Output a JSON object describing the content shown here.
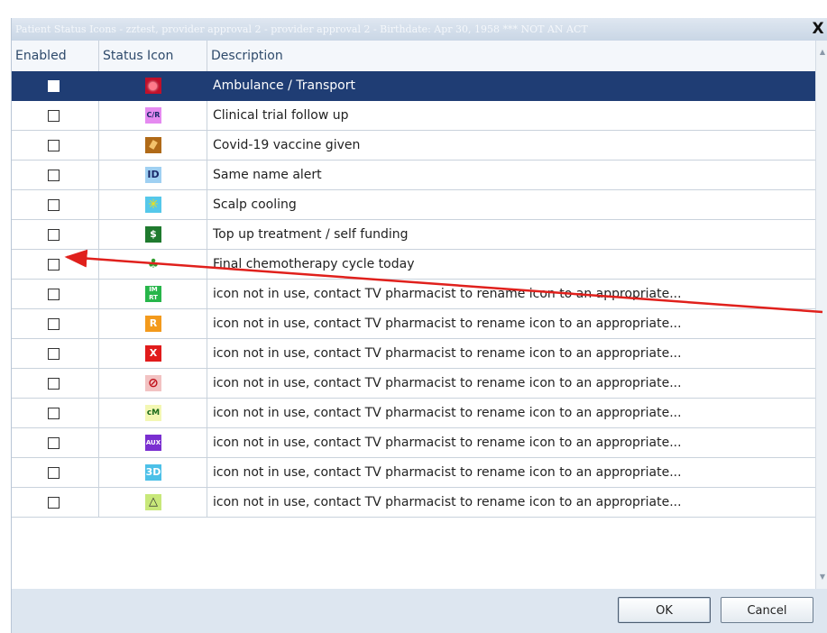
{
  "dialog": {
    "title": "Patient Status Icons - zztest, provider approval 2  - provider approval 2 - Birthdate: Apr 30, 1958 *** NOT AN ACT",
    "close_label": "X"
  },
  "columns": [
    "Enabled",
    "Status Icon",
    "Description"
  ],
  "rows": [
    {
      "enabled": false,
      "icon": "ambulance-icon",
      "icon_text": "",
      "icon_color": "#c0102a",
      "description": "Ambulance / Transport",
      "selected": true
    },
    {
      "enabled": false,
      "icon": "clinical-trial-icon",
      "icon_text": "C/R",
      "icon_color": "#e58af0",
      "description": "Clinical trial follow up"
    },
    {
      "enabled": false,
      "icon": "covid-vaccine-icon",
      "icon_text": "",
      "icon_color": "#b06a18",
      "description": "Covid-19 vaccine given"
    },
    {
      "enabled": false,
      "icon": "id-alert-icon",
      "icon_text": "ID",
      "icon_color": "#9fd0f2",
      "description": "Same name alert"
    },
    {
      "enabled": false,
      "icon": "scalp-cooling-icon",
      "icon_text": "✳",
      "icon_color": "#55c8ea",
      "description": "Scalp cooling"
    },
    {
      "enabled": false,
      "icon": "self-funding-icon",
      "icon_text": "$",
      "icon_color": "#1f7a2e",
      "description": "Top up treatment / self funding"
    },
    {
      "enabled": false,
      "icon": "tree-icon",
      "icon_text": "♣",
      "icon_color": "#ffffff",
      "description": "Final chemotherapy cycle today"
    },
    {
      "enabled": false,
      "icon": "imrt-icon",
      "icon_text": "IM RT",
      "icon_color": "#27b64a",
      "description": "icon not in use, contact TV pharmacist to rename icon to an appropriate..."
    },
    {
      "enabled": false,
      "icon": "r-icon",
      "icon_text": "R",
      "icon_color": "#f39a1c",
      "description": "icon not in use, contact TV pharmacist to rename icon to an appropriate..."
    },
    {
      "enabled": false,
      "icon": "x-icon",
      "icon_text": "X",
      "icon_color": "#e11b1b",
      "description": "icon not in use, contact TV pharmacist to rename icon to an appropriate..."
    },
    {
      "enabled": false,
      "icon": "no-entry-icon",
      "icon_text": "⊘",
      "icon_color": "#f2c2c2",
      "description": "icon not in use, contact TV pharmacist to rename icon to an appropriate..."
    },
    {
      "enabled": false,
      "icon": "cm-icon",
      "icon_text": "cM",
      "icon_color": "#f3f7b3",
      "description": "icon not in use, contact TV pharmacist to rename icon to an appropriate..."
    },
    {
      "enabled": false,
      "icon": "aux-icon",
      "icon_text": "AUX",
      "icon_color": "#7a2fd0",
      "description": "icon not in use, contact TV pharmacist to rename icon to an appropriate..."
    },
    {
      "enabled": false,
      "icon": "3d-icon",
      "icon_text": "3D",
      "icon_color": "#4cc0e8",
      "description": "icon not in use, contact TV pharmacist to rename  icon to an appropriate..."
    },
    {
      "enabled": false,
      "icon": "warning-triangle-icon",
      "icon_text": "△",
      "icon_color": "#c8e87a",
      "description": "icon not in use, contact TV pharmacist to rename icon to an appropriate..."
    }
  ],
  "buttons": {
    "ok": "OK",
    "cancel": "Cancel"
  },
  "colors": {
    "selection": "#1f3d74",
    "annotation_arrow": "#e0201c"
  }
}
